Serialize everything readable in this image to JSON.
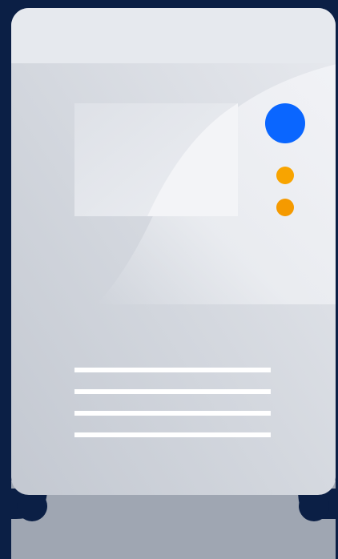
{
  "illustration": {
    "subject": "server-tower",
    "colors": {
      "background": "#0b1f45",
      "case_top": "#e6e9ee",
      "case_body_light": "#e3e6ec",
      "case_body_dark": "#c4c9d3",
      "base": "#9fa6b2",
      "panel": "#eceef2",
      "highlight": "#f4f5f8",
      "power_led": "#0a66ff",
      "status_led_1": "#f8a400",
      "status_led_2": "#f59a00",
      "vent_line": "#ffffff"
    },
    "status_leds": [
      "status-led-1",
      "status-led-2"
    ],
    "vent_lines": [
      "vent-line-1",
      "vent-line-2",
      "vent-line-3",
      "vent-line-4"
    ]
  }
}
